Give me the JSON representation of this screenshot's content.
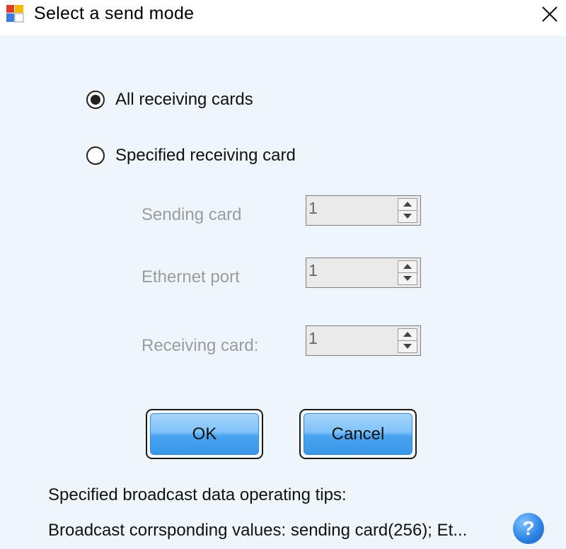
{
  "window": {
    "title": "Select a send mode",
    "icon": "app-window-icon",
    "close_icon": "close-icon"
  },
  "mode_options": [
    {
      "label": "All receiving cards",
      "selected": true
    },
    {
      "label": "Specified receiving card",
      "selected": false
    }
  ],
  "fields": [
    {
      "label": "Sending card",
      "value": "1",
      "enabled": false
    },
    {
      "label": "Ethernet port",
      "value": "1",
      "enabled": false
    },
    {
      "label": "Receiving card:",
      "value": "1",
      "enabled": false
    }
  ],
  "buttons": {
    "ok_label": "OK",
    "cancel_label": "Cancel"
  },
  "tips": {
    "title": "Specified broadcast data operating tips:",
    "text": "Broadcast corrsponding values: sending card(256); Et...",
    "help_icon": "help-icon"
  },
  "colors": {
    "background": "#eef6fb",
    "button_blue": "#4aa3f0",
    "disabled_text": "#9a9ca0",
    "help_blue": "#2f86e6"
  }
}
